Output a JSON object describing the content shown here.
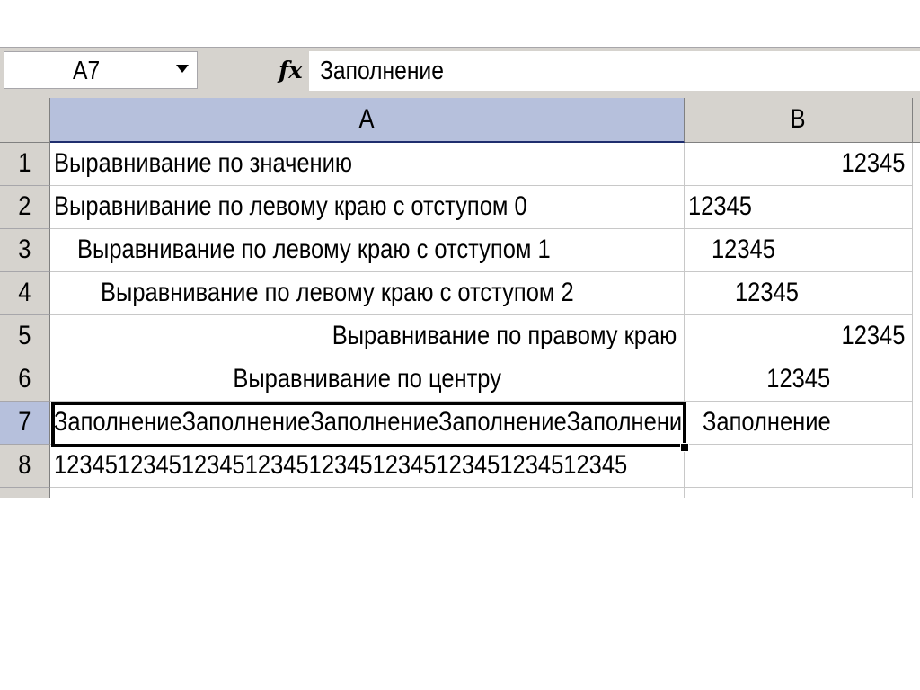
{
  "formula_bar": {
    "name_box": "A7",
    "fx_label": "fx",
    "formula": "Заполнение"
  },
  "columns": [
    "A",
    "B"
  ],
  "rows": [
    {
      "num": "1",
      "a": "Выравнивание по значению",
      "b": "12345"
    },
    {
      "num": "2",
      "a": "Выравнивание по левому краю с отступом 0",
      "b": "12345"
    },
    {
      "num": "3",
      "a": "Выравнивание по левому краю с отступом 1",
      "b": "12345"
    },
    {
      "num": "4",
      "a": "Выравнивание по левому краю с отступом 2",
      "b": "12345"
    },
    {
      "num": "5",
      "a": "Выравнивание по правому краю",
      "b": "12345"
    },
    {
      "num": "6",
      "a": "Выравнивание по центру",
      "b": "12345"
    },
    {
      "num": "7",
      "a": "ЗаполнениеЗаполнениеЗаполнениеЗаполнениеЗаполнение",
      "b": "Заполнение"
    },
    {
      "num": "8",
      "a": "123451234512345123451234512345123451234512345",
      "b": ""
    }
  ],
  "selected_cell": "A7",
  "colors": {
    "header_bg": "#d6d3ce",
    "active_header_bg": "#b6c0dc",
    "gridline": "#c8c8c8",
    "selection_border": "#000000"
  }
}
